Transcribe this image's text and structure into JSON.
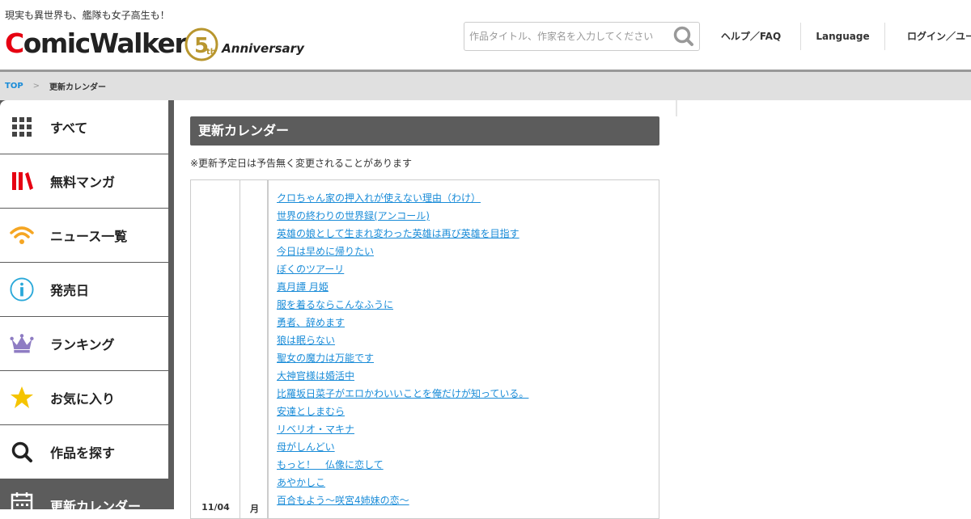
{
  "header": {
    "tagline": "現実も異世界も、艦隊も女子高生も！",
    "logo": {
      "prefix": "C",
      "rest": "omicWalker",
      "badge_number": "5",
      "badge_suffix": "th",
      "anniversary": "Anniversary"
    },
    "search": {
      "placeholder": "作品タイトル、作家名を入力してください",
      "value": ""
    },
    "nav": {
      "help": "ヘルプ／FAQ",
      "language": "Language",
      "login": "ログイン／ユーザー登録"
    }
  },
  "breadcrumb": {
    "top": "TOP",
    "current": "更新カレンダー"
  },
  "sidebar": {
    "items": [
      {
        "label": "すべて",
        "icon": "grid-icon"
      },
      {
        "label": "無料マンガ",
        "icon": "books-icon"
      },
      {
        "label": "ニュース一覧",
        "icon": "wifi-icon"
      },
      {
        "label": "発売日",
        "icon": "info-icon"
      },
      {
        "label": "ランキング",
        "icon": "crown-icon"
      },
      {
        "label": "お気に入り",
        "icon": "star-icon"
      },
      {
        "label": "作品を探す",
        "icon": "search-icon"
      },
      {
        "label": "更新カレンダー",
        "icon": "calendar-icon"
      }
    ]
  },
  "main": {
    "title": "更新カレンダー",
    "note": "※更新予定日は予告無く変更されることがあります",
    "calendar": {
      "date": "11/04",
      "day": "月",
      "titles": [
        "クロちゃん家の押入れが使えない理由（わけ）",
        "世界の終わりの世界録(アンコール)",
        "英雄の娘として生まれ変わった英雄は再び英雄を目指す",
        "今日は早めに帰りたい",
        "ぼくのツアーリ",
        "真月譚 月姫",
        "服を着るならこんなふうに",
        "勇者、辞めます",
        "狼は眠らない",
        "聖女の魔力は万能です",
        "大神官様は婚活中",
        "比羅坂日菜子がエロかわいいことを俺だけが知っている。",
        "安達としまむら",
        "リベリオ・マキナ",
        "母がしんどい",
        "もっと！　仏像に恋して",
        "あやかしこ",
        "百合もよう～咲宮4姉妹の恋～"
      ]
    }
  },
  "colors": {
    "accent_red": "#e60012",
    "link_blue": "#1a8cd8",
    "gold": "#b8962e",
    "sidebar_dark": "#5c5c5c"
  }
}
